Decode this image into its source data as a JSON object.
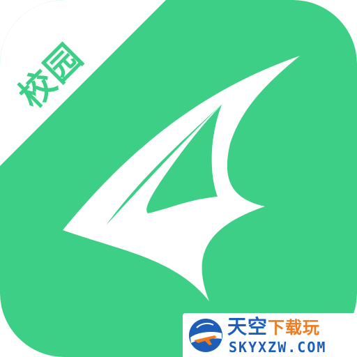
{
  "app_icon": {
    "badge_text": "校园",
    "icon_name": "paper-plane-wing-logo",
    "colors": {
      "brand_green": "#3ccf85",
      "badge_background": "#ffffff",
      "mark": "#ffffff"
    }
  },
  "watermark": {
    "logo_icon": "globe-airplane-logo",
    "title_main": "天空",
    "title_sub": "下载玩",
    "domain": "SKYXZW.COM",
    "colors": {
      "blue": "#1d5fb8",
      "orange": "#f07a1f"
    }
  }
}
